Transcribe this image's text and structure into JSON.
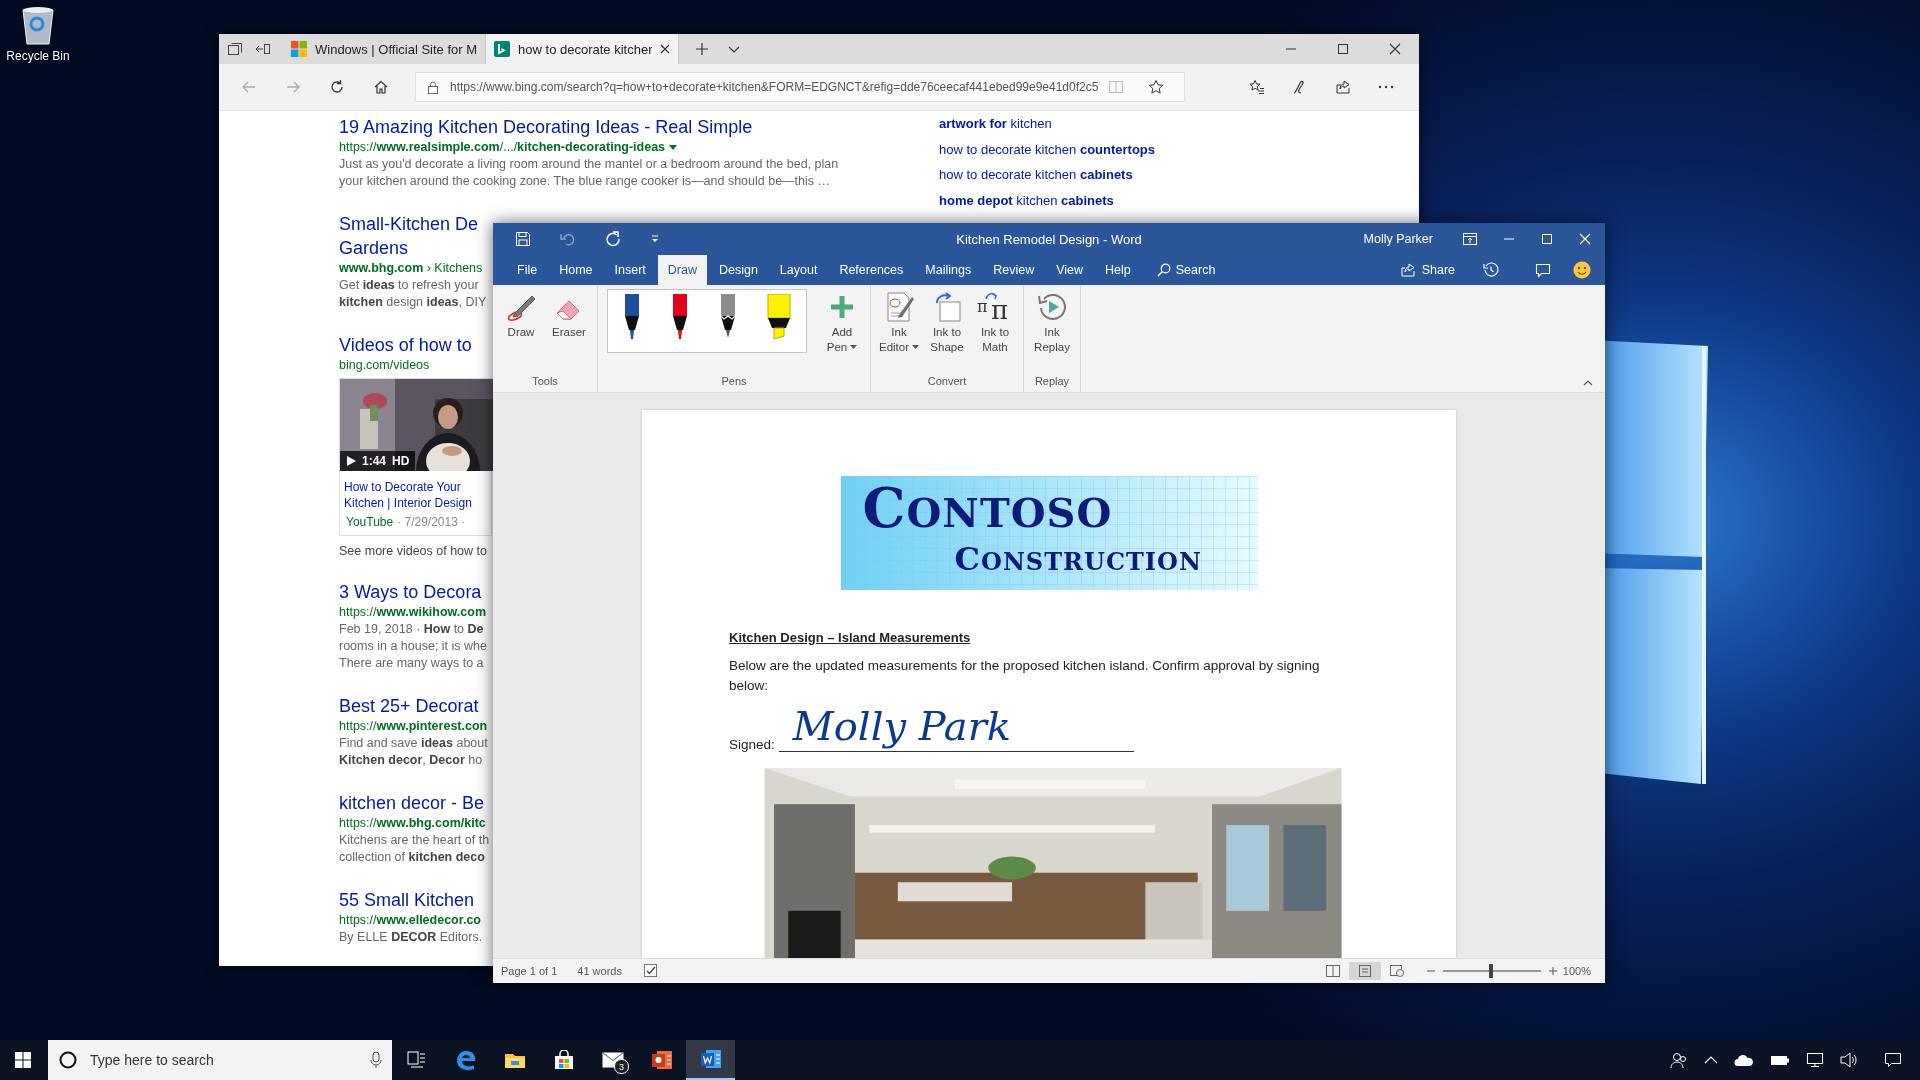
{
  "desktop": {
    "icons": [
      {
        "label": "Recycle Bin"
      }
    ]
  },
  "browser": {
    "tabs": [
      {
        "kind": "windows",
        "title": "Windows | Official Site for M",
        "selected": false
      },
      {
        "kind": "bing",
        "title": "how to decorate kitcher",
        "selected": true
      }
    ],
    "address": "https://www.bing.com/search?q=how+to+decorate+kitchen&FORM=EDGNCT&refig=dde76ceecaf441ebed99e9e41d0f2c5",
    "results": [
      {
        "kind": "web",
        "title_lines": [
          "19 Amazing Kitchen Decorating Ideas - Real Simple"
        ],
        "url": "https://**www.realsimple.com**/.../**kitchen-decorating-ideas**",
        "dropdown": true,
        "snippet_lines": [
          "Just as you'd decorate a living room around the mantel or a bedroom around the bed, plan",
          "your kitchen around the cooking zone. The blue range cooker is—and should be—this …"
        ]
      },
      {
        "kind": "web",
        "title_lines": [
          "Small-Kitchen De",
          "Gardens"
        ],
        "url": "**www.bhg.com** › Kitchens",
        "dropdown": false,
        "snippet_lines": [
          "Get **ideas** to refresh your",
          "**kitchen** design **ideas**, DIY"
        ]
      },
      {
        "kind": "video",
        "title_lines": [
          "Videos of how to"
        ],
        "url": "bing.com/videos",
        "video": {
          "duration": "1:44",
          "quality": "HD",
          "caption": "How to Decorate Your Kitchen | Interior Design",
          "source": "YouTube",
          "date": "· 7/29/2013 ·"
        },
        "more": "See more videos of how to"
      },
      {
        "kind": "web",
        "title_lines": [
          "3 Ways to Decora"
        ],
        "url": "https://**www.wikihow.com**",
        "dropdown": false,
        "snippet_lines": [
          "Feb 19, 2018 · **How** to **De**",
          "rooms in a house; it is whe",
          "There are many ways to a"
        ]
      },
      {
        "kind": "web",
        "title_lines": [
          "Best 25+ Decorat"
        ],
        "url": "https://**www.pinterest.con**",
        "dropdown": false,
        "snippet_lines": [
          "Find and save **ideas** about",
          "**Kitchen decor**, **Decor** ho"
        ]
      },
      {
        "kind": "web",
        "title_lines": [
          "kitchen decor - Be"
        ],
        "url": "https://**www.bhg.com/kitc**",
        "dropdown": false,
        "snippet_lines": [
          "Kitchens are the heart of th",
          "collection of **kitchen deco**"
        ]
      },
      {
        "kind": "web",
        "title_lines": [
          "55 Small Kitchen"
        ],
        "url": "https://**www.elledecor.co**",
        "dropdown": false,
        "snippet_lines": [
          "By ELLE **DECOR** Editors."
        ]
      }
    ],
    "related": [
      "**artwork for** kitchen",
      "how to decorate kitchen **countertops**",
      "how to decorate kitchen **cabinets**",
      "**home depot** kitchen **cabinets**"
    ]
  },
  "word": {
    "quick_access": [
      {
        "kind": "save",
        "disabled": false
      },
      {
        "kind": "undo",
        "disabled": true
      },
      {
        "kind": "redo",
        "disabled": false
      },
      {
        "kind": "customize",
        "disabled": false
      }
    ],
    "title": "Kitchen Remodel Design - Word",
    "user": "Molly Parker",
    "tabs": [
      {
        "label": "File",
        "selected": false
      },
      {
        "label": "Home",
        "selected": false
      },
      {
        "label": "Insert",
        "selected": false
      },
      {
        "label": "Draw",
        "selected": true
      },
      {
        "label": "Design",
        "selected": false
      },
      {
        "label": "Layout",
        "selected": false
      },
      {
        "label": "References",
        "selected": false
      },
      {
        "label": "Mailings",
        "selected": false
      },
      {
        "label": "Review",
        "selected": false
      },
      {
        "label": "View",
        "selected": false
      },
      {
        "label": "Help",
        "selected": false
      }
    ],
    "search": "Search",
    "share": "Share",
    "ribbon": {
      "groups": [
        {
          "label": "Tools",
          "items": [
            {
              "kind": "draw",
              "label": "Draw"
            },
            {
              "kind": "eraser",
              "label": "Eraser"
            }
          ]
        },
        {
          "label": "Pens",
          "items": [
            {
              "kind": "pen",
              "color": "#1f4e9c"
            },
            {
              "kind": "pen",
              "color": "#e3001b"
            },
            {
              "kind": "pencil",
              "color": "#8c8c8c"
            },
            {
              "kind": "highlighter",
              "color": "#fff200"
            },
            {
              "kind": "add-pen",
              "label": "Add Pen",
              "dropdown": true
            }
          ]
        },
        {
          "label": "Convert",
          "items": [
            {
              "kind": "ink-editor",
              "label": "Ink Editor",
              "dropdown": true
            },
            {
              "kind": "ink-to-shape",
              "label": "Ink to Shape"
            },
            {
              "kind": "ink-to-math",
              "label": "Ink to Math",
              "symbols": [
                "π",
                "π"
              ]
            }
          ]
        },
        {
          "label": "Replay",
          "items": [
            {
              "kind": "ink-replay",
              "label": "Ink Replay"
            }
          ]
        }
      ]
    },
    "document": {
      "logo": [
        "CONTOSO",
        "CONSTRUCTION"
      ],
      "heading": "Kitchen Design – Island Measurements",
      "body": "Below are the updated measurements for the proposed kitchen island. Confirm approval by signing below:",
      "signed_label": "Signed:",
      "signature": "Molly Park"
    },
    "status": {
      "page": "Page 1 of 1",
      "words": "41 words",
      "views": [
        {
          "kind": "read",
          "selected": false
        },
        {
          "kind": "print",
          "selected": true
        },
        {
          "kind": "web",
          "selected": false
        }
      ],
      "zoom": {
        "level": 0.49,
        "reading": "100%"
      }
    }
  },
  "taskbar": {
    "search": {
      "placeholder": "Type here to search"
    },
    "apps": [
      {
        "kind": "task-view",
        "active": false
      },
      {
        "kind": "edge",
        "active": false
      },
      {
        "kind": "explorer",
        "active": false
      },
      {
        "kind": "store",
        "active": false
      },
      {
        "kind": "mail",
        "badge": "3",
        "active": false
      },
      {
        "kind": "powerpoint",
        "active": false
      },
      {
        "kind": "word",
        "active": true
      }
    ]
  }
}
